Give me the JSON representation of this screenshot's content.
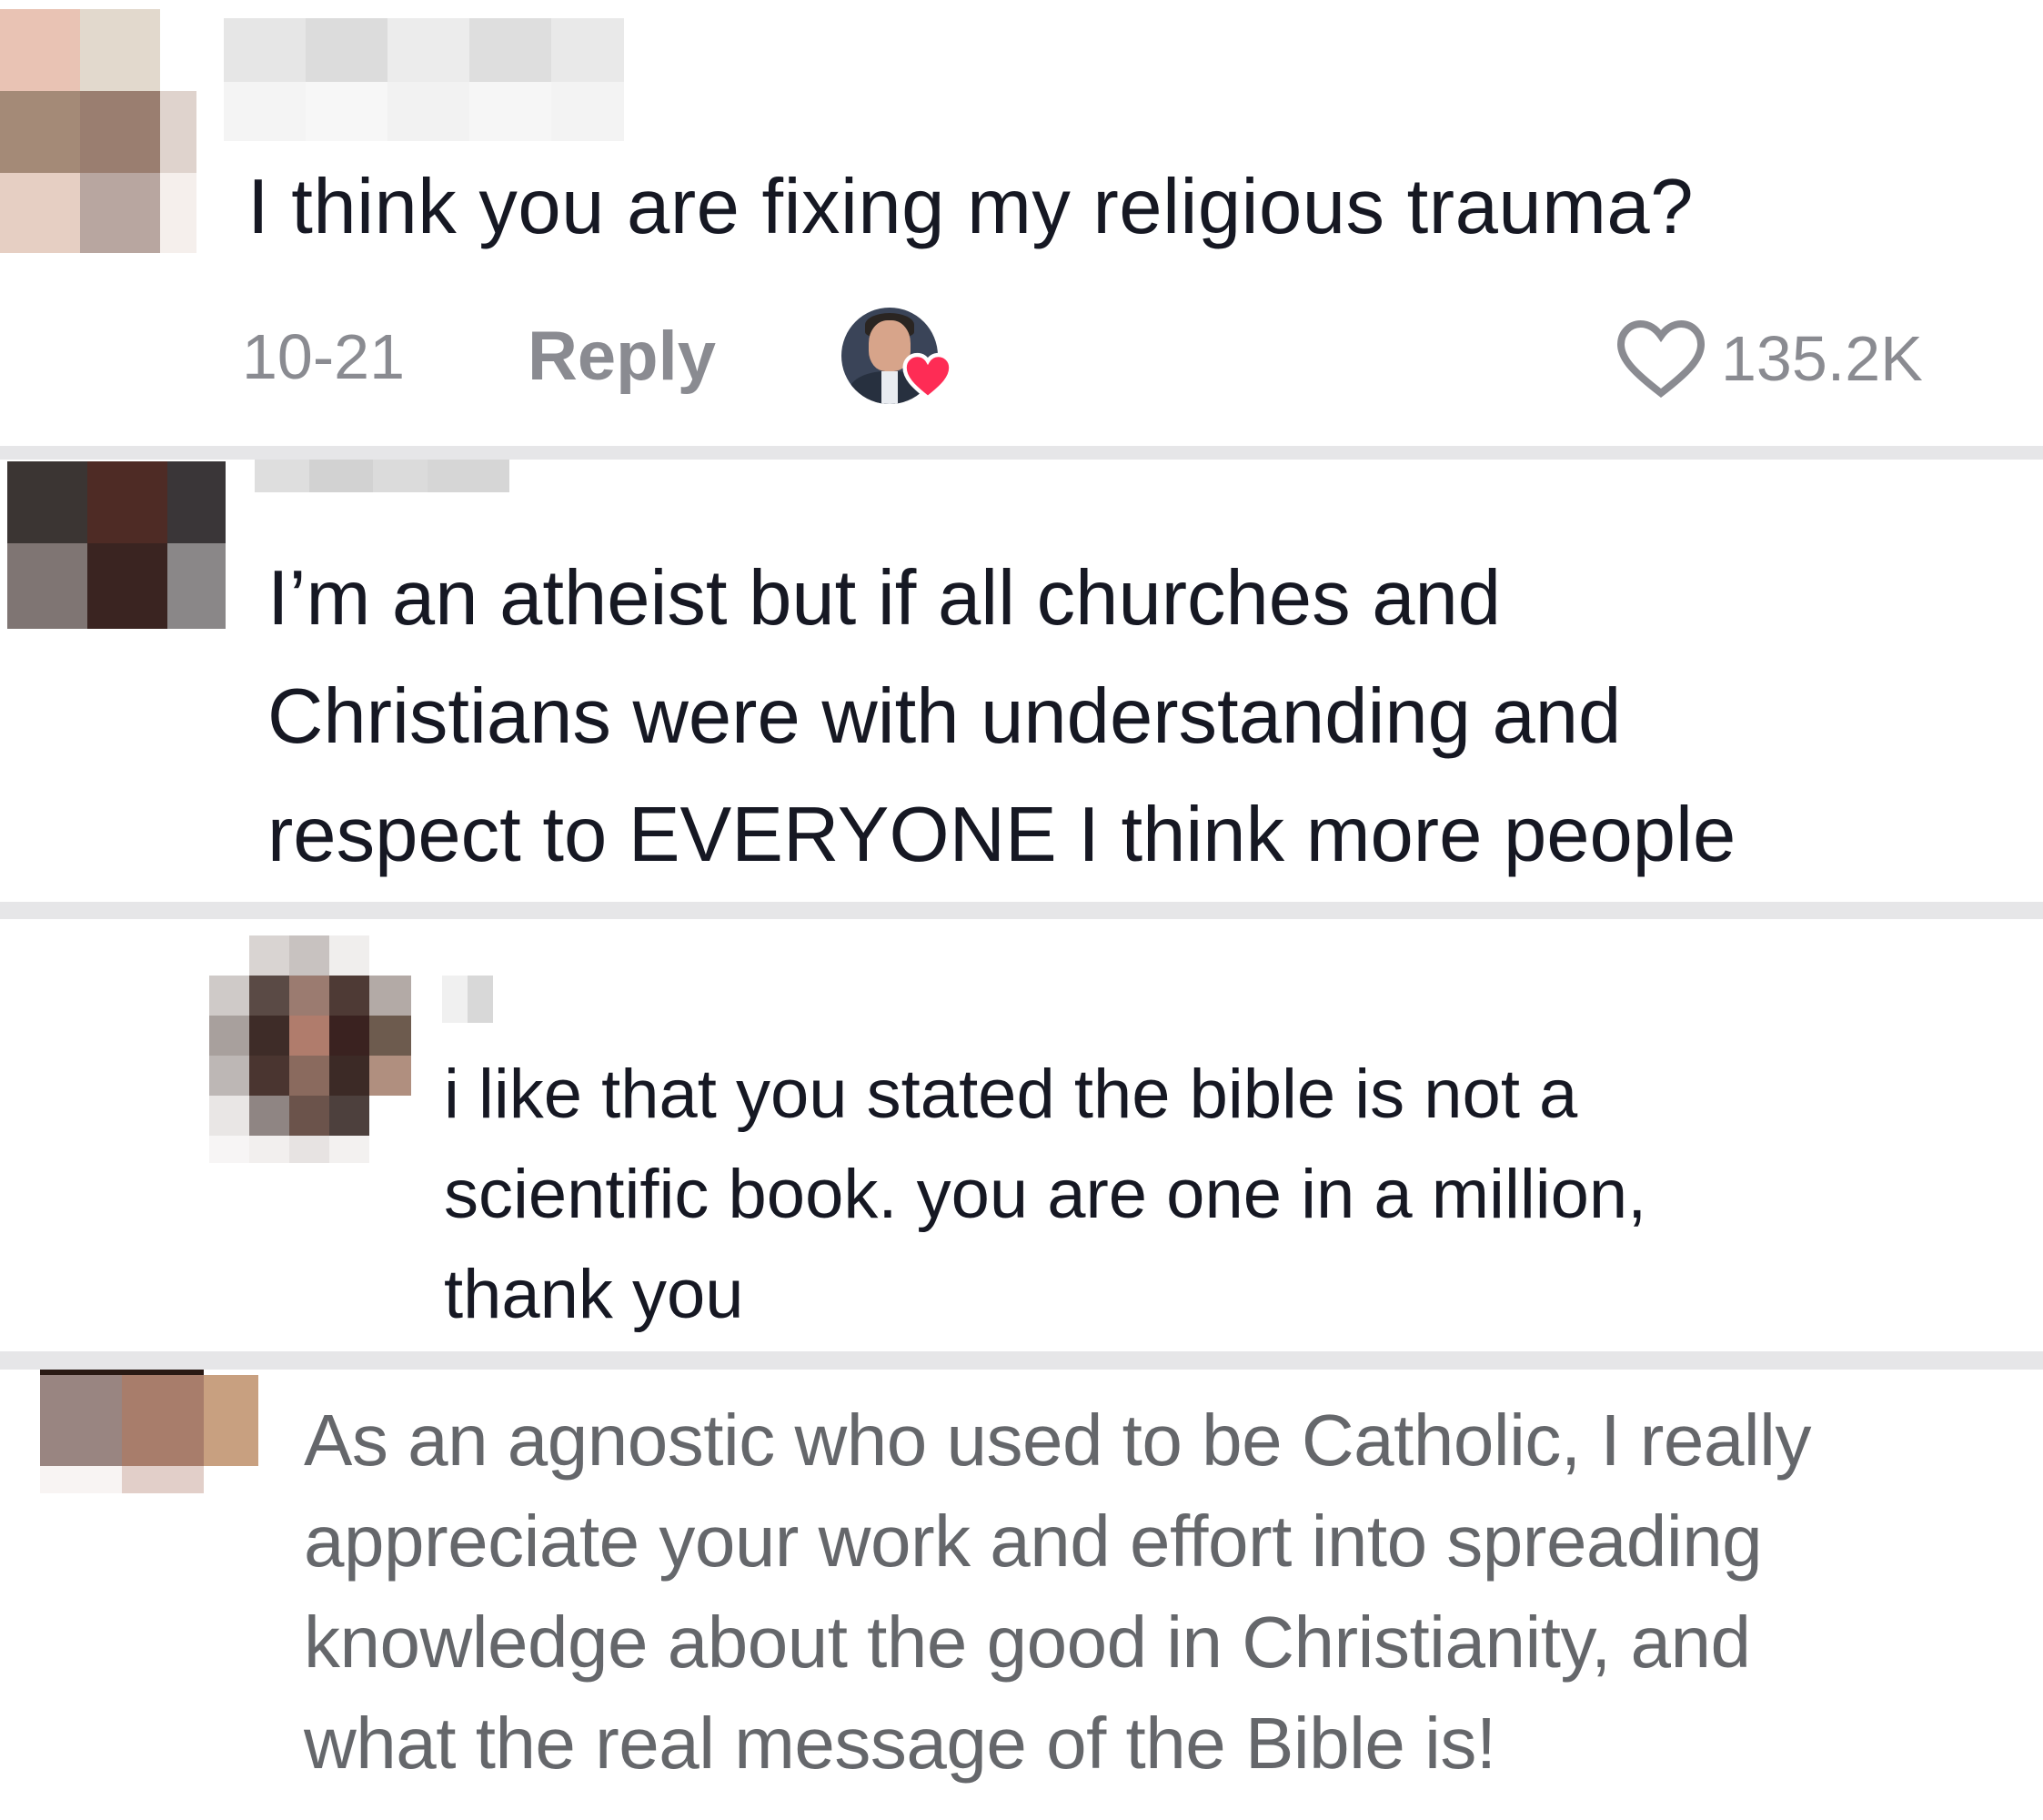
{
  "comments": [
    {
      "text": "I think you are fixing my religious trauma?",
      "date": "10-21",
      "reply_label": "Reply",
      "likes": "135.2K",
      "creator_liked": true
    },
    {
      "text": "I’m an atheist but if all churches and\nChristians were with understanding and\nrespect to EVERYONE I think more people"
    },
    {
      "text": "i like that you stated the bible is not a\nscientific book. you are one in a million,\nthank you"
    },
    {
      "text": "As an agnostic who used to be Catholic, I really\nappreciate your work and effort into spreading\nknowledge about the good in Christianity, and\nwhat the real message of the Bible is!"
    }
  ],
  "colors": {
    "text_primary": "#161823",
    "text_secondary": "#8a8b91",
    "heart_badge": "#fe2c55",
    "divider": "#e6e6e8"
  },
  "icons": {
    "like": "heart-outline-icon",
    "creator_like": "heart-filled-icon"
  }
}
